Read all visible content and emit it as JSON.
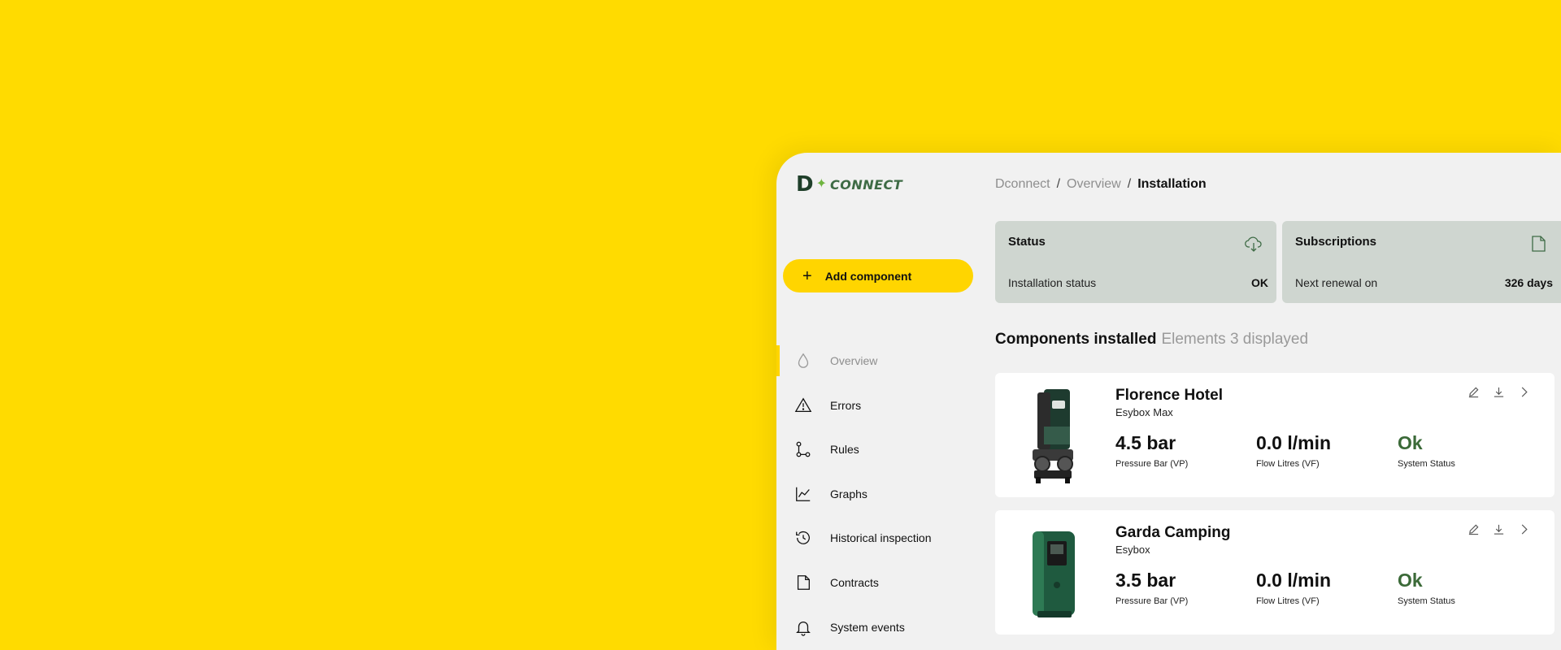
{
  "app": {
    "logo_letter": "D",
    "logo_text": "CONNECT"
  },
  "sidebar": {
    "add_button_label": "Add component",
    "items": [
      {
        "label": "Overview",
        "icon": "drop-icon",
        "active": true
      },
      {
        "label": "Errors",
        "icon": "warning-icon"
      },
      {
        "label": "Rules",
        "icon": "rules-icon"
      },
      {
        "label": "Graphs",
        "icon": "graph-icon"
      },
      {
        "label": "Historical inspection",
        "icon": "history-icon"
      },
      {
        "label": "Contracts",
        "icon": "document-icon"
      },
      {
        "label": "System events",
        "icon": "bell-icon"
      }
    ]
  },
  "breadcrumb": {
    "items": [
      "Dconnect",
      "Overview"
    ],
    "separator": "/",
    "current": "Installation"
  },
  "status_card": {
    "title": "Status",
    "icon": "cloud-icon",
    "row_label": "Installation status",
    "row_value": "OK"
  },
  "subscriptions_card": {
    "title": "Subscriptions",
    "icon": "document-icon",
    "row_label": "Next renewal on",
    "row_value": "326 days"
  },
  "components": {
    "title": "Components installed",
    "subtitle": "Elements 3 displayed",
    "items": [
      {
        "name": "Florence Hotel",
        "model": "Esybox Max",
        "pressure": "4.5 bar",
        "pressure_label": "Pressure Bar (VP)",
        "flow": "0.0 l/min",
        "flow_label": "Flow Litres (VF)",
        "status": "Ok",
        "status_label": "System Status"
      },
      {
        "name": "Garda Camping",
        "model": "Esybox",
        "pressure": "3.5 bar",
        "pressure_label": "Pressure Bar (VP)",
        "flow": "0.0 l/min",
        "flow_label": "Flow Litres (VF)",
        "status": "Ok",
        "status_label": "System Status"
      }
    ]
  },
  "colors": {
    "background": "#FFDB00",
    "accent": "#FFD500",
    "card": "#CFD6D0",
    "ok": "#3B6A38"
  }
}
